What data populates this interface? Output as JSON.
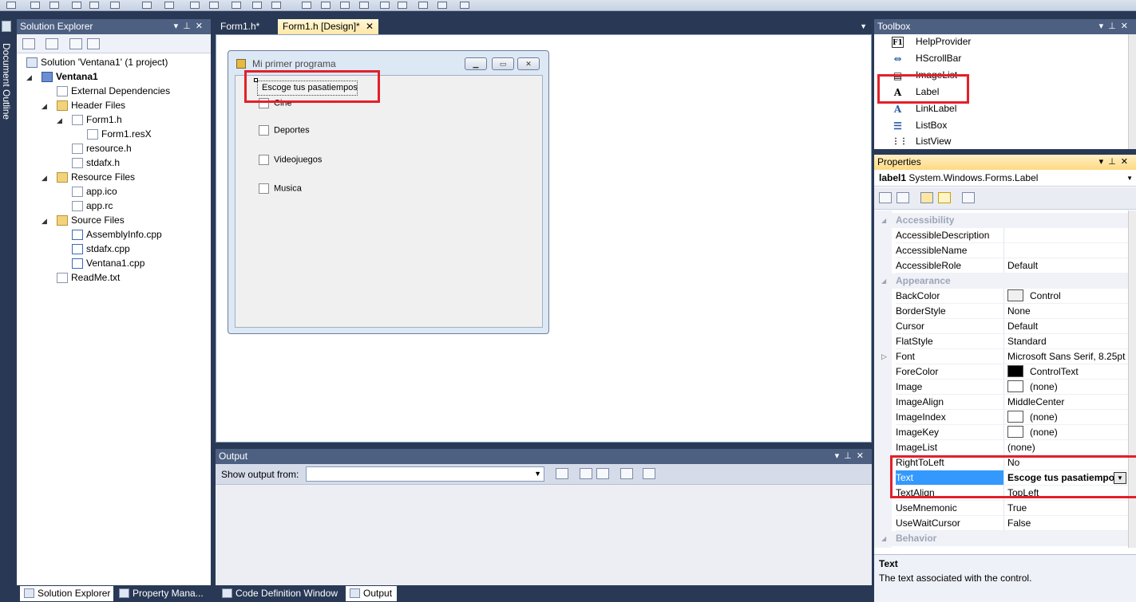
{
  "solution_explorer": {
    "title": "Solution Explorer",
    "items": [
      {
        "label": "Solution 'Ventana1' (1 project)",
        "icon": "solution-icon"
      },
      {
        "label": "Ventana1",
        "icon": "project-icon"
      },
      {
        "label": "External Dependencies",
        "icon": "dependencies-icon"
      },
      {
        "label": "Header Files",
        "icon": "folder-icon"
      },
      {
        "label": "Form1.h",
        "icon": "form-icon"
      },
      {
        "label": "Form1.resX",
        "icon": "resx-icon"
      },
      {
        "label": "resource.h",
        "icon": "header-file-icon"
      },
      {
        "label": "stdafx.h",
        "icon": "header-file-icon"
      },
      {
        "label": "Resource Files",
        "icon": "folder-icon"
      },
      {
        "label": "app.ico",
        "icon": "ico-file-icon"
      },
      {
        "label": "app.rc",
        "icon": "rc-file-icon"
      },
      {
        "label": "Source Files",
        "icon": "folder-icon"
      },
      {
        "label": "AssemblyInfo.cpp",
        "icon": "cpp-file-icon"
      },
      {
        "label": "stdafx.cpp",
        "icon": "cpp-file-icon"
      },
      {
        "label": "Ventana1.cpp",
        "icon": "cpp-file-icon"
      },
      {
        "label": "ReadMe.txt",
        "icon": "text-file-icon"
      }
    ]
  },
  "doc_outline": {
    "label": "Document Outline"
  },
  "doc_tabs": [
    {
      "label": "Form1.h*"
    },
    {
      "label": "Form1.h [Design]*"
    }
  ],
  "form": {
    "title": "Mi primer programa",
    "label_text": "Escoge tus pasatiempos",
    "checkboxes": [
      "Cine",
      "Deportes",
      "Videojuegos",
      "Musica"
    ]
  },
  "output": {
    "title": "Output",
    "show_from_label": "Show output from:",
    "show_from_value": ""
  },
  "bottom_tabs": [
    {
      "label": "Solution Explorer"
    },
    {
      "label": "Property Mana..."
    },
    {
      "label": "Code Definition Window"
    },
    {
      "label": "Output"
    }
  ],
  "toolbox": {
    "title": "Toolbox",
    "items": [
      {
        "label": "HelpProvider",
        "glyph": "F1"
      },
      {
        "label": "HScrollBar",
        "glyph": "⇔"
      },
      {
        "label": "ImageList",
        "glyph": "▤"
      },
      {
        "label": "Label",
        "glyph": "A"
      },
      {
        "label": "LinkLabel",
        "glyph": "A"
      },
      {
        "label": "ListBox",
        "glyph": "☰"
      },
      {
        "label": "ListView",
        "glyph": "⋮⋮"
      }
    ]
  },
  "properties": {
    "title": "Properties",
    "object_name": "label1",
    "object_type": "System.Windows.Forms.Label",
    "rows": [
      {
        "kind": "cat",
        "name": "Accessibility"
      },
      {
        "name": "AccessibleDescription",
        "value": ""
      },
      {
        "name": "AccessibleName",
        "value": ""
      },
      {
        "name": "AccessibleRole",
        "value": "Default"
      },
      {
        "kind": "cat",
        "name": "Appearance"
      },
      {
        "name": "BackColor",
        "value": "Control",
        "swatch": "#f0f0f0"
      },
      {
        "name": "BorderStyle",
        "value": "None"
      },
      {
        "name": "Cursor",
        "value": "Default"
      },
      {
        "name": "FlatStyle",
        "value": "Standard"
      },
      {
        "name": "Font",
        "value": "Microsoft Sans Serif, 8.25pt",
        "expand": true
      },
      {
        "name": "ForeColor",
        "value": "ControlText",
        "swatch": "#000000"
      },
      {
        "name": "Image",
        "value": "(none)",
        "swatch": "#ffffff"
      },
      {
        "name": "ImageAlign",
        "value": "MiddleCenter"
      },
      {
        "name": "ImageIndex",
        "value": "(none)",
        "swatch": "#ffffff"
      },
      {
        "name": "ImageKey",
        "value": "(none)",
        "swatch": "#ffffff"
      },
      {
        "name": "ImageList",
        "value": "(none)"
      },
      {
        "name": "RightToLeft",
        "value": "No"
      },
      {
        "name": "Text",
        "value": "Escoge tus pasatiempos",
        "selected": true
      },
      {
        "name": "TextAlign",
        "value": "TopLeft"
      },
      {
        "name": "UseMnemonic",
        "value": "True"
      },
      {
        "name": "UseWaitCursor",
        "value": "False"
      },
      {
        "kind": "cat",
        "name": "Behavior"
      }
    ],
    "description_title": "Text",
    "description_text": "The text associated with the control."
  },
  "colors": {
    "highlight_red": "#e32029",
    "selection_blue": "#3399ff",
    "ide_background": "#293955"
  }
}
